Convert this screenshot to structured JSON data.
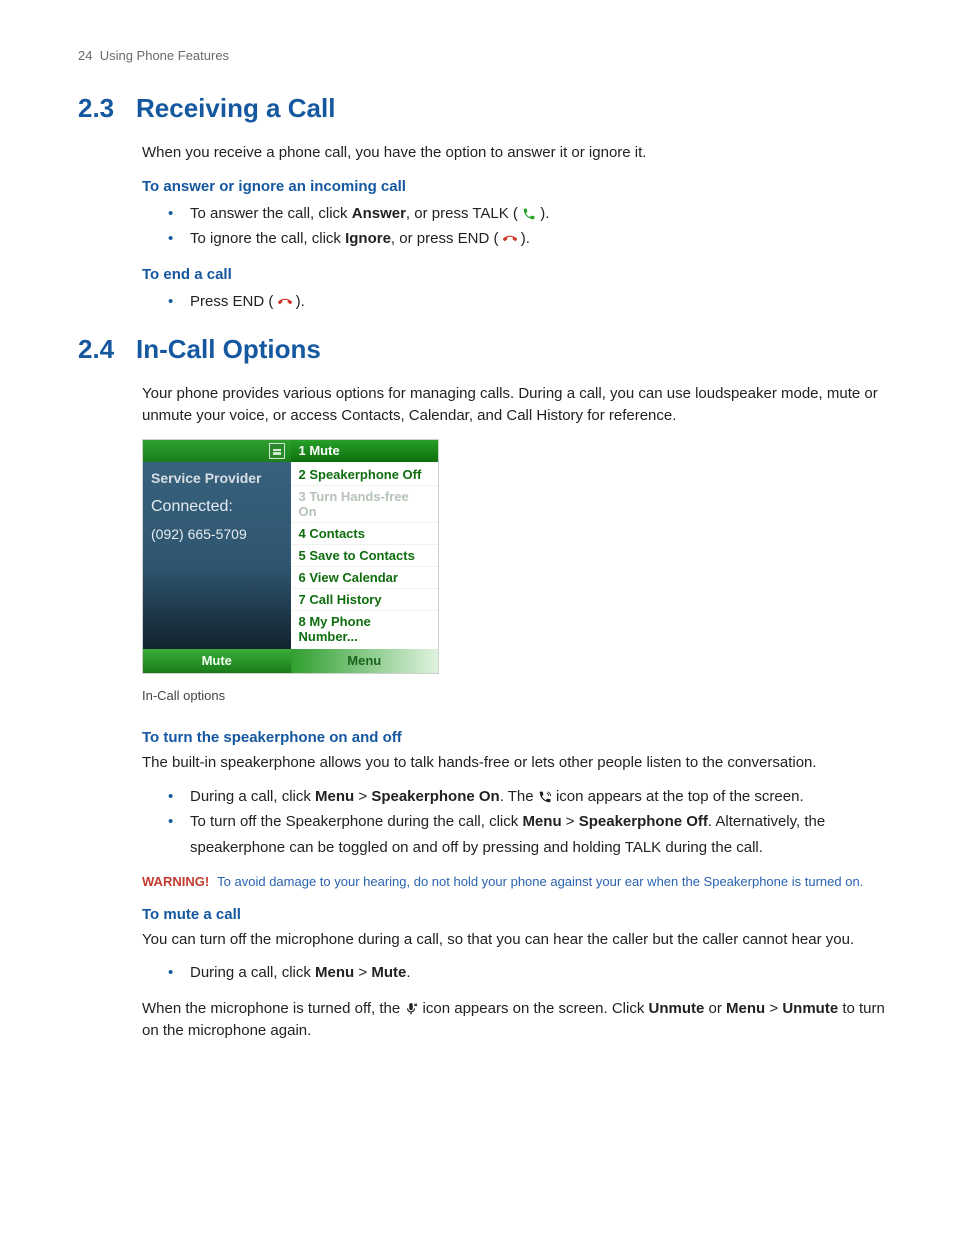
{
  "header": {
    "page_number": 24,
    "chapter": "Using Phone Features"
  },
  "sections": [
    {
      "num": "2.3",
      "title": "Receiving a Call",
      "intro": "When you receive a phone call, you have the option to answer it or ignore it.",
      "sub": [
        {
          "heading": "To answer or ignore an incoming call",
          "bullets": [
            {
              "pre": "To answer the call, click ",
              "bold1": "Answer",
              "mid": ", or press TALK ( ",
              "icon": "talk",
              "post": " )."
            },
            {
              "pre": "To ignore the call, click ",
              "bold1": "Ignore",
              "mid": ", or press END ( ",
              "icon": "end",
              "post": " )."
            }
          ]
        },
        {
          "heading": "To end a call",
          "bullets": [
            {
              "pre": "Press END ( ",
              "icon": "end",
              "post": " )."
            }
          ]
        }
      ]
    },
    {
      "num": "2.4",
      "title": "In-Call Options",
      "intro": "Your phone provides various options for managing calls. During a call, you can use loudspeaker mode, mute or unmute your voice, or access Contacts, Calendar, and Call History for reference.",
      "mock": {
        "left": {
          "provider": "Service Provider",
          "status": "Connected:",
          "number": "(092) 665-5709",
          "softkey": "Mute"
        },
        "right": {
          "top": "1 Mute",
          "items": [
            {
              "label": "2 Speakerphone Off",
              "enabled": true
            },
            {
              "label": "3 Turn Hands-free On",
              "enabled": false
            },
            {
              "label": "4 Contacts",
              "enabled": true
            },
            {
              "label": "5 Save to Contacts",
              "enabled": true
            },
            {
              "label": "6 View Calendar",
              "enabled": true
            },
            {
              "label": "7 Call History",
              "enabled": true
            },
            {
              "label": "8 My Phone Number...",
              "enabled": true
            }
          ],
          "softkey": "Menu"
        }
      },
      "caption": "In-Call options",
      "sub": [
        {
          "heading": "To turn the speakerphone on and off",
          "para": "The built-in speakerphone allows you to talk hands-free or lets other people listen to the conversation.",
          "bullets": [
            {
              "pre": "During a call, click ",
              "bold1": "Menu",
              "sep1": " > ",
              "bold2": "Speakerphone On",
              "mid": ". The ",
              "icon": "speaker",
              "post": " icon appears at the top of the screen."
            },
            {
              "pre": "To turn off the Speakerphone during the call, click ",
              "bold1": "Menu",
              "sep1": " > ",
              "bold2": "Speakerphone Off",
              "mid": ". Alternatively, the speakerphone can be toggled on and off by pressing and holding TALK during the call."
            }
          ],
          "warning": {
            "label": "WARNING!",
            "text": "To avoid damage to your hearing, do not hold your phone against your ear when the Speakerphone is turned on."
          }
        },
        {
          "heading": "To mute a call",
          "para": "You can turn off the microphone during a call, so that you can hear the caller but the caller cannot hear you.",
          "bullets": [
            {
              "pre": "During a call, click ",
              "bold1": "Menu",
              "sep1": " > ",
              "bold2": "Mute",
              "mid": "."
            }
          ],
          "outro_parts": {
            "pre": "When the microphone is turned off, the ",
            "icon": "mute",
            "mid": " icon appears on the screen. Click ",
            "bold1": "Unmute",
            "sep1": " or ",
            "bold2": "Menu",
            "sep2": " > ",
            "bold3": "Unmute",
            "post": " to turn on the microphone again."
          }
        }
      ]
    }
  ]
}
